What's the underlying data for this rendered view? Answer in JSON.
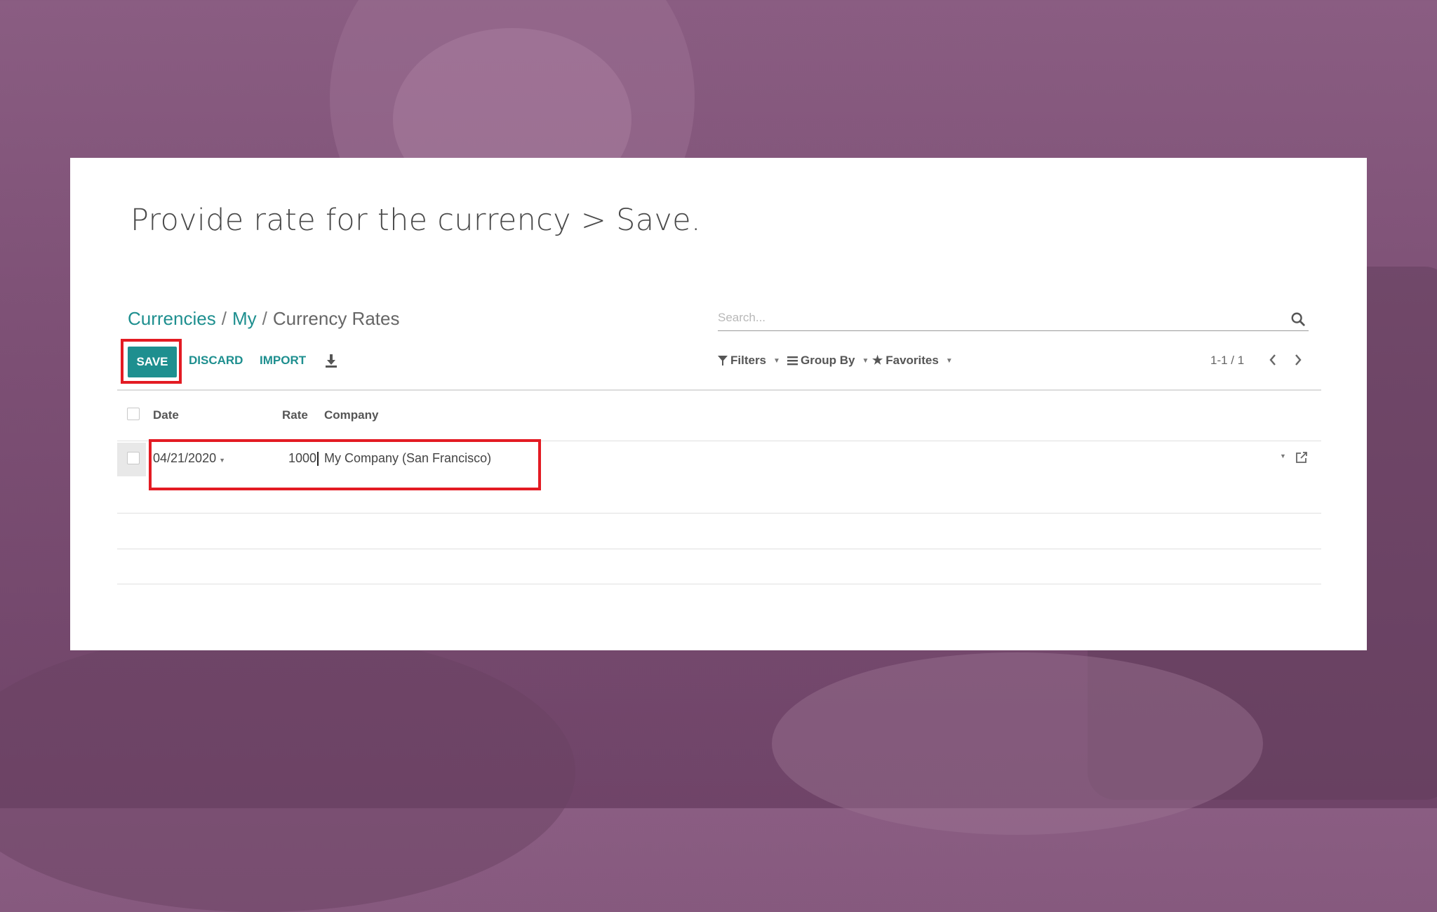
{
  "heading": "Provide rate for the currency > Save.",
  "breadcrumb": {
    "items": [
      "Currencies",
      "My"
    ],
    "separator": "/",
    "current": "Currency Rates"
  },
  "search": {
    "placeholder": "Search..."
  },
  "toolbar": {
    "save_label": "SAVE",
    "discard_label": "DISCARD",
    "import_label": "IMPORT"
  },
  "search_options": {
    "filters": "Filters",
    "group_by": "Group By",
    "favorites": "Favorites"
  },
  "pager": {
    "value": "1-1 / 1"
  },
  "table": {
    "columns": [
      "Date",
      "Rate",
      "Company"
    ],
    "rows": [
      {
        "date": "04/21/2020",
        "rate": "1000",
        "company": "My Company (San Francisco)"
      }
    ]
  },
  "colors": {
    "accent": "#1e8f8f",
    "highlight": "#e31b23",
    "background_overlay": "#7c4f74"
  },
  "icons": [
    "search-icon",
    "download-icon",
    "filter-icon",
    "list-icon",
    "star-icon",
    "chevron-left-icon",
    "chevron-right-icon",
    "external-link-icon"
  ]
}
